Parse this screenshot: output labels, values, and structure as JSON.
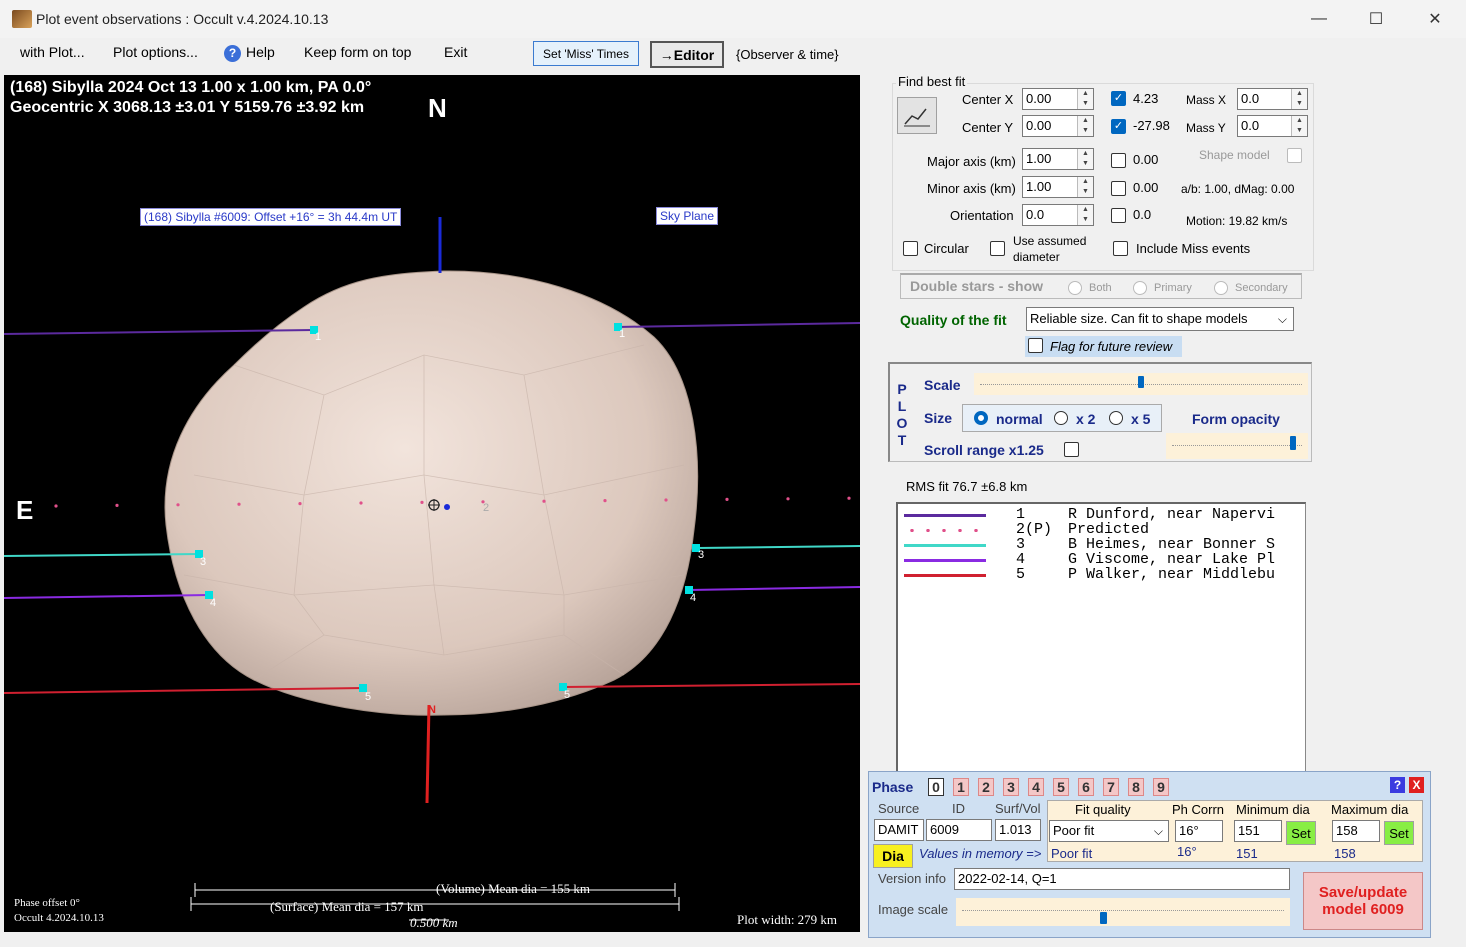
{
  "window": {
    "title": "Plot event observations : Occult v.4.2024.10.13",
    "minimize": "—",
    "maximize": "☐",
    "close": "✕"
  },
  "menu": {
    "with_plot": "with Plot...",
    "plot_options": "Plot options...",
    "help": "Help",
    "keep_on_top": "Keep form on top",
    "exit": "Exit",
    "set_miss_times": "Set 'Miss' Times",
    "editor": "→Editor",
    "observer_time": "{Observer & time}"
  },
  "plot": {
    "header_line1": "(168) Sibylla  2024 Oct 13   1.00 x 1.00 km, PA 0.0°",
    "header_line2": "Geocentric  X  3068.13 ±3.01  Y 5159.76 ±3.92 km",
    "north": "N",
    "east": "E",
    "model_label": "(168) Sibylla #6009: Offset +16° =  3h 44.4m UT",
    "sky_plane": "Sky Plane",
    "volume_dia": "(Volume) Mean dia = 155 km",
    "surface_dia": "(Surface) Mean dia = 157 km",
    "scale_km": "0.500 km",
    "phase_offset": "Phase offset 0°",
    "occult_version": "Occult 4.2024.10.13",
    "plot_width": "Plot width: 279 km",
    "chord_numbers": [
      "1",
      "1",
      "2",
      "3",
      "3",
      "4",
      "4",
      "5",
      "5"
    ],
    "south_mark": "N"
  },
  "fit": {
    "group_title": "Find best fit",
    "center_x_label": "Center X",
    "center_x": "0.00",
    "center_y_label": "Center Y",
    "center_y": "0.00",
    "center_x_result": "4.23",
    "center_y_result": "-27.98",
    "mass_x_label": "Mass X",
    "mass_x": "0.0",
    "mass_y_label": "Mass Y",
    "mass_y": "0.0",
    "major_label": "Major axis (km)",
    "major": "1.00",
    "major_result": "0.00",
    "minor_label": "Minor axis (km)",
    "minor": "1.00",
    "minor_result": "0.00",
    "orientation_label": "Orientation",
    "orientation": "0.0",
    "orientation_result": "0.0",
    "shape_model": "Shape model",
    "ab_dmag": "a/b: 1.00, dMag: 0.00",
    "motion": "Motion: 19.82 km/s",
    "circular": "Circular",
    "use_assumed": "Use assumed",
    "diameter": "diameter",
    "include_miss": "Include Miss events"
  },
  "double_stars": {
    "label": "Double stars - show",
    "both": "Both",
    "primary": "Primary",
    "secondary": "Secondary"
  },
  "quality": {
    "label": "Quality of the fit",
    "value": "Reliable size. Can fit to shape models",
    "flag_review": "Flag for future review"
  },
  "plot_panel": {
    "side_label": [
      "P",
      "L",
      "O",
      "T"
    ],
    "scale": "Scale",
    "size": "Size",
    "normal": "normal",
    "x2": "x 2",
    "x5": "x 5",
    "form_opacity": "Form opacity",
    "scroll_range": "Scroll range x1.25",
    "scale_level": 0.5,
    "opacity_level": 0.95
  },
  "rms": "RMS fit 76.7 ±6.8 km",
  "legend": [
    {
      "num": "1",
      "tag": "   ",
      "name": "R Dunford, near Napervi",
      "color": "#5b2a9e",
      "style": "solid"
    },
    {
      "num": "2",
      "tag": "(P)",
      "name": "Predicted",
      "color": "#e0508a",
      "style": "dots"
    },
    {
      "num": "3",
      "tag": "   ",
      "name": "B Heimes, near Bonner S",
      "color": "#40d8c8",
      "style": "solid"
    },
    {
      "num": "4",
      "tag": "   ",
      "name": "G Viscome, near Lake Pl",
      "color": "#8a2be2",
      "style": "solid"
    },
    {
      "num": "5",
      "tag": "   ",
      "name": "P Walker, near Middlebu",
      "color": "#d02030",
      "style": "solid"
    }
  ],
  "phase": {
    "label": "Phase",
    "digits": [
      "0",
      "1",
      "2",
      "3",
      "4",
      "5",
      "6",
      "7",
      "8",
      "9"
    ],
    "help": "?",
    "close": "X",
    "source_label": "Source",
    "id_label": "ID",
    "surfvol_label": "Surf/Vol",
    "fit_quality_label": "Fit quality",
    "ph_corrn_label": "Ph Corrn",
    "min_dia_label": "Minimum dia",
    "max_dia_label": "Maximum dia",
    "source": "DAMIT",
    "id": "6009",
    "surfvol": "1.013",
    "fit_quality": "Poor fit",
    "ph_corrn": "16°",
    "min_dia": "151",
    "max_dia": "158",
    "set": "Set",
    "dia_btn": "Dia",
    "values_in_memory": "Values in memory =>",
    "mem_fit": "Poor fit",
    "mem_ph": "16°",
    "mem_min": "151",
    "mem_max": "158",
    "version_label": "Version info",
    "version": "2022-02-14, Q=1",
    "image_scale_label": "Image scale",
    "save_update": "Save/update",
    "save_model": "model 6009"
  }
}
